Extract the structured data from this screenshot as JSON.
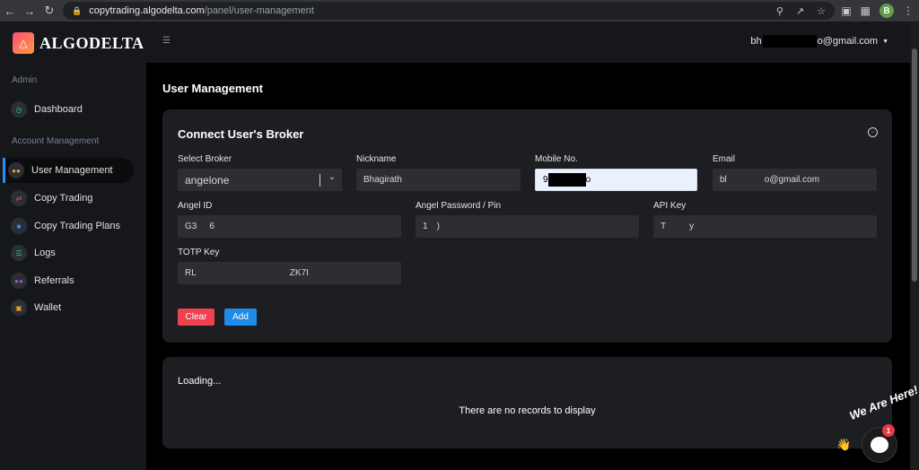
{
  "browser": {
    "url_host": "copytrading.algodelta.com",
    "url_path": "/panel/user-management",
    "profile_initial": "B"
  },
  "brand": {
    "name": "ALGODELTA"
  },
  "sidebar": {
    "admin_label": "Admin",
    "dashboard": "Dashboard",
    "account_label": "Account Management",
    "items": [
      {
        "label": "User Management",
        "icon": "users-icon",
        "color": "#f0a030"
      },
      {
        "label": "Copy Trading",
        "icon": "copy-trading-icon",
        "color": "#e74c3c"
      },
      {
        "label": "Copy Trading Plans",
        "icon": "plans-icon",
        "color": "#2b8ff3"
      },
      {
        "label": "Logs",
        "icon": "logs-icon",
        "color": "#2ecc71"
      },
      {
        "label": "Referrals",
        "icon": "referrals-icon",
        "color": "#9b59b6"
      },
      {
        "label": "Wallet",
        "icon": "wallet-icon",
        "color": "#f0a030"
      }
    ]
  },
  "header": {
    "email_prefix": "bh",
    "email_suffix": "o@gmail.com"
  },
  "page": {
    "title": "User Management"
  },
  "form": {
    "title": "Connect User's Broker",
    "select_broker_label": "Select Broker",
    "select_broker_value": "angelone",
    "nickname_label": "Nickname",
    "nickname_value": "Bhagirath",
    "mobile_label": "Mobile No.",
    "mobile_value_start": "9",
    "mobile_value_end": "o",
    "email_label": "Email",
    "email_value_start": "bl",
    "email_value_end": "o@gmail.com",
    "angel_id_label": "Angel ID",
    "angel_id_start": "G3",
    "angel_id_end": "6",
    "angel_password_label": "Angel Password / Pin",
    "angel_password_start": "1",
    "angel_password_end": ")",
    "api_key_label": "API Key",
    "api_key_start": "T",
    "api_key_end": "y",
    "totp_label": "TOTP Key",
    "totp_start": "RL",
    "totp_end": "ZK7I",
    "clear_label": "Clear",
    "add_label": "Add"
  },
  "table": {
    "loading": "Loading...",
    "empty": "There are no records to display"
  },
  "chat": {
    "tagline": "We Are Here!",
    "count": "1"
  }
}
